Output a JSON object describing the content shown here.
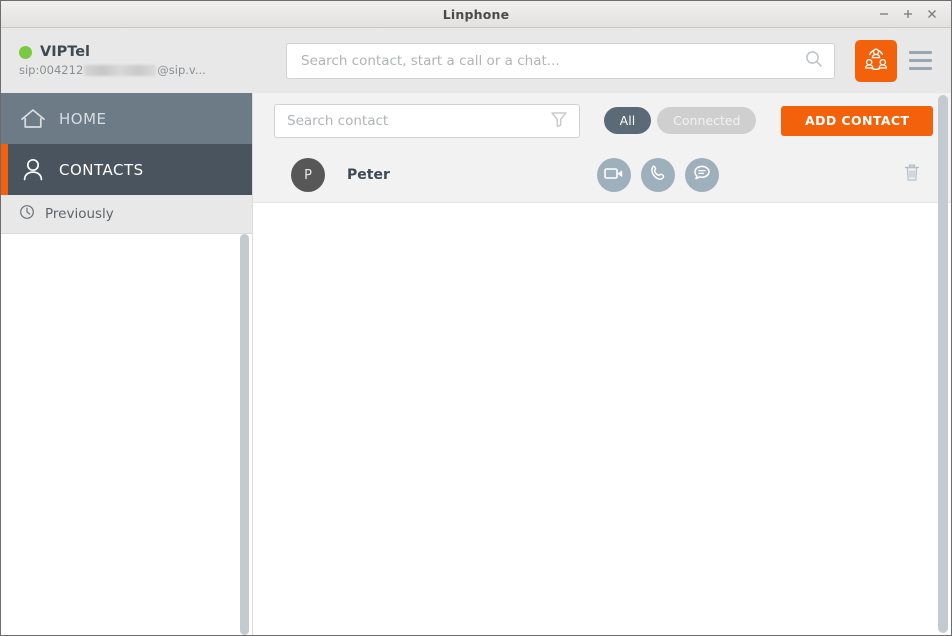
{
  "window": {
    "title": "Linphone",
    "minimize_label": "−",
    "maximize_label": "+",
    "close_label": "×"
  },
  "account": {
    "name": "VIPTel",
    "status_color": "#7ac943",
    "sip_prefix": "sip:004212",
    "sip_suffix": "@sip.v...",
    "sip_redacted": true
  },
  "search": {
    "placeholder": "Search contact, start a call or a chat...",
    "value": "",
    "icon": "search-icon"
  },
  "header_actions": {
    "conference_icon": "conference-icon",
    "menu_icon": "hamburger-menu-icon"
  },
  "sidebar": {
    "items": [
      {
        "label": "HOME",
        "icon": "home-icon",
        "active": false
      },
      {
        "label": "CONTACTS",
        "icon": "person-icon",
        "active": true
      }
    ],
    "subitem": {
      "label": "Previously",
      "icon": "clock-icon"
    }
  },
  "toolbar": {
    "contact_search_placeholder": "Search contact",
    "contact_search_value": "",
    "filter_icon": "filter-funnel-icon",
    "filters": [
      {
        "label": "All",
        "active": true
      },
      {
        "label": "Connected",
        "active": false
      }
    ],
    "add_contact_label": "ADD CONTACT"
  },
  "contacts": [
    {
      "name": "Peter",
      "avatar_initial": "P",
      "actions": [
        {
          "icon": "video-call-icon",
          "label": "Video call"
        },
        {
          "icon": "phone-call-icon",
          "label": "Call"
        },
        {
          "icon": "chat-icon",
          "label": "Chat"
        }
      ],
      "delete_icon": "trash-icon"
    }
  ],
  "colors": {
    "accent_orange": "#f4610b",
    "sidebar_active": "#49545e",
    "sidebar_inactive": "#6d7b87",
    "action_circle": "#9fb0bd",
    "status_green": "#7ac943"
  }
}
